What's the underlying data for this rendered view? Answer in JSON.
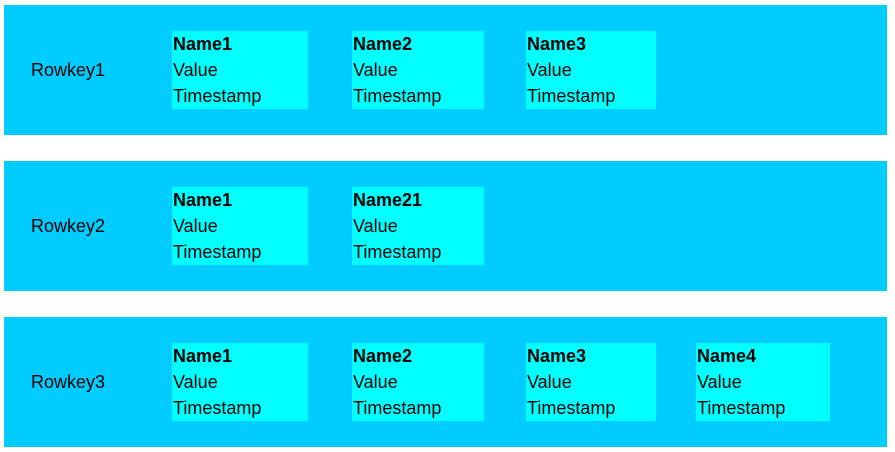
{
  "colors": {
    "row_background": "#00ccff",
    "cell_background": "#00ffff",
    "page_background": "#ffffff",
    "text": "#000000"
  },
  "rows": [
    {
      "rowkey": "Rowkey1",
      "cells": [
        {
          "name": "Name1",
          "value": "Value",
          "timestamp": "Timestamp"
        },
        {
          "name": "Name2",
          "value": "Value",
          "timestamp": "Timestamp"
        },
        {
          "name": "Name3",
          "value": "Value",
          "timestamp": "Timestamp"
        }
      ]
    },
    {
      "rowkey": "Rowkey2",
      "cells": [
        {
          "name": "Name1",
          "value": "Value",
          "timestamp": "Timestamp"
        },
        {
          "name": "Name21",
          "value": "Value",
          "timestamp": "Timestamp"
        }
      ]
    },
    {
      "rowkey": "Rowkey3",
      "cells": [
        {
          "name": "Name1",
          "value": "Value",
          "timestamp": "Timestamp"
        },
        {
          "name": "Name2",
          "value": "Value",
          "timestamp": "Timestamp"
        },
        {
          "name": "Name3",
          "value": "Value",
          "timestamp": "Timestamp"
        },
        {
          "name": "Name4",
          "value": "Value",
          "timestamp": "Timestamp"
        }
      ]
    }
  ]
}
